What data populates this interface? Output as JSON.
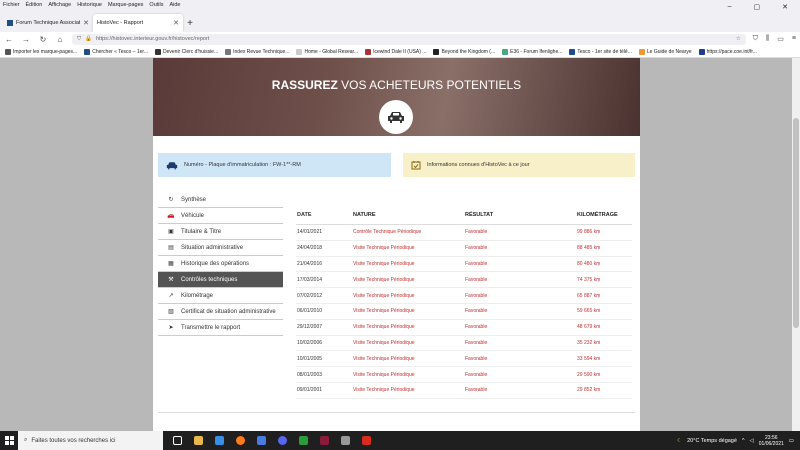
{
  "menubar": {
    "items": [
      "Fichier",
      "Édition",
      "Affichage",
      "Historique",
      "Marque-pages",
      "Outils",
      "Aide"
    ]
  },
  "tabs": [
    {
      "title": "Forum Technique Associatif de"
    },
    {
      "title": "HistoVec - Rapport"
    }
  ],
  "url": {
    "text": "https://histovec.interieur.gouv.fr/histovec/report"
  },
  "bookmarks": [
    {
      "label": "Importer les marque-pages...",
      "color": "#555"
    },
    {
      "label": "Chercher « Tesco – 1er...",
      "color": "#1e4d8c"
    },
    {
      "label": "Devenir Clerc d'huissie...",
      "color": "#333"
    },
    {
      "label": "Index Revue Technique...",
      "color": "#777"
    },
    {
      "label": "Home - Global Resear...",
      "color": "#ccc"
    },
    {
      "label": "Icewind Dale II (USA) ...",
      "color": "#a33"
    },
    {
      "label": "Beyond the Kingdom (...",
      "color": "#222"
    },
    {
      "label": "E36 - Forum Ifenlighe...",
      "color": "#4a7"
    },
    {
      "label": "Tesco - 1er site de télé...",
      "color": "#1e4d8c"
    },
    {
      "label": "Le Guide de Nearye",
      "color": "#e93"
    },
    {
      "label": "https://pace.coe.int/fr...",
      "color": "#1e3e8c"
    }
  ],
  "hero": {
    "title_bold": "RASSUREZ",
    "title_rest": " VOS ACHETEURS POTENTIELS"
  },
  "cards": {
    "plate": "Numéro - Plaque d'immatriculation : FW-1**-RM",
    "info": "Informations connues d'HistoVec à ce jour"
  },
  "menu": {
    "items": [
      {
        "label": "Synthèse",
        "icon": "sync-icon"
      },
      {
        "label": "Véhicule",
        "icon": "car-icon"
      },
      {
        "label": "Titulaire & Titre",
        "icon": "id-card-icon"
      },
      {
        "label": "Situation administrative",
        "icon": "document-icon"
      },
      {
        "label": "Historique des opérations",
        "icon": "calendar-icon"
      },
      {
        "label": "Contrôles techniques",
        "icon": "wrench-icon"
      },
      {
        "label": "Kilométrage",
        "icon": "chart-icon"
      },
      {
        "label": "Certificat de situation administrative",
        "icon": "certificate-icon"
      },
      {
        "label": "Transmettre le rapport",
        "icon": "send-icon"
      }
    ],
    "active_index": 5
  },
  "table": {
    "headers": [
      "DATE",
      "NATURE",
      "RÉSULTAT",
      "KILOMÉTRAGE"
    ],
    "rows": [
      [
        "14/01/2021",
        "Contrôle Technique Périodique",
        "Favorable",
        "99 886 km"
      ],
      [
        "24/04/2018",
        "Visite Technique Périodique",
        "Favorable",
        "88 485 km"
      ],
      [
        "21/04/2016",
        "Visite Technique Périodique",
        "Favorable",
        "80 480 km"
      ],
      [
        "17/03/2014",
        "Visite Technique Périodique",
        "Favorable",
        "74 375 km"
      ],
      [
        "07/02/2012",
        "Visite Technique Périodique",
        "Favorable",
        "65 887 km"
      ],
      [
        "06/01/2010",
        "Visite Technique Périodique",
        "Favorable",
        "59 665 km"
      ],
      [
        "29/12/2007",
        "Visite Technique Périodique",
        "Favorable",
        "48 679 km"
      ],
      [
        "10/02/2006",
        "Visite Technique Périodique",
        "Favorable",
        "35 232 km"
      ],
      [
        "10/01/2005",
        "Visite Technique Périodique",
        "Favorable",
        "33 594 km"
      ],
      [
        "08/01/2003",
        "Visite Technique Périodique",
        "Favorable",
        "29 590 km"
      ],
      [
        "09/01/2001",
        "Visite Technique Périodique",
        "Favorable",
        "29 852 km"
      ]
    ]
  },
  "taskbar": {
    "search_placeholder": "Faites toutes vos recherches ici",
    "weather": "20°C  Temps dégagé",
    "time": "23:56",
    "date": "01/06/2021"
  }
}
